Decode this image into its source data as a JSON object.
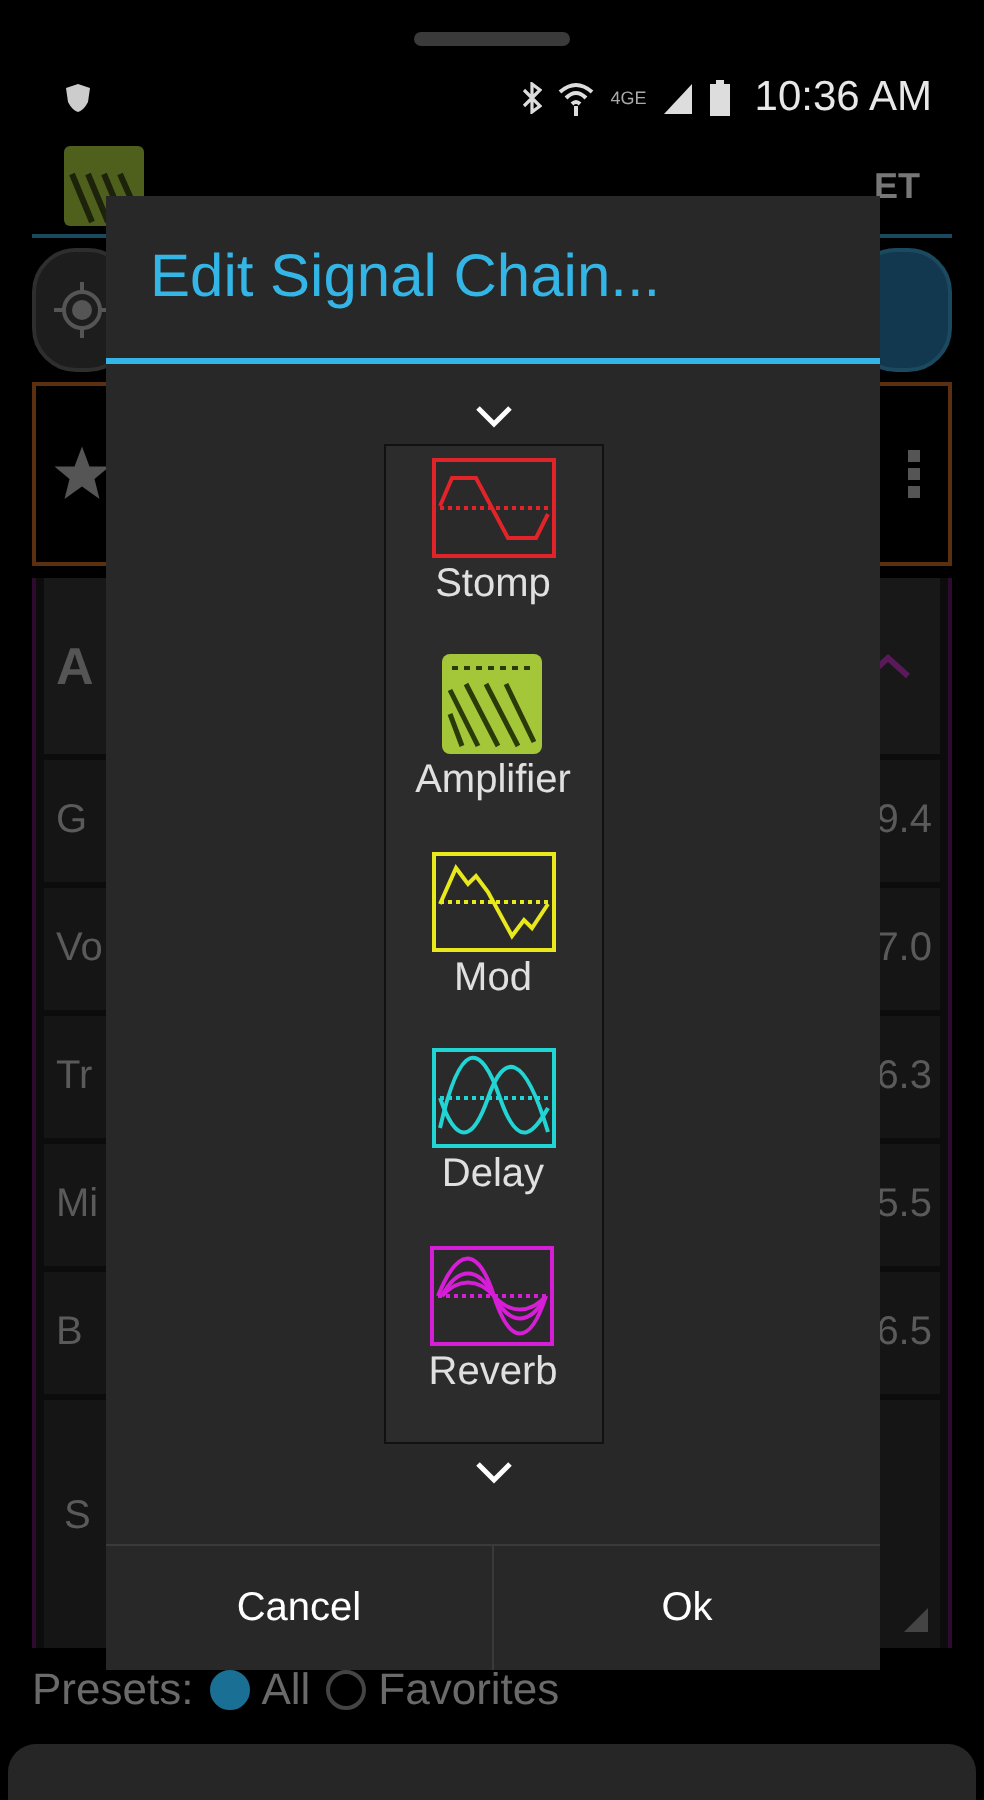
{
  "status_bar": {
    "network_label": "4GE",
    "time": "10:36 AM"
  },
  "background": {
    "tab_partial": "ET",
    "section_partial": "A",
    "params": [
      {
        "label": "G",
        "value": "9.4"
      },
      {
        "label": "Vo",
        "value": "7.0"
      },
      {
        "label": "Tr",
        "value": "6.3"
      },
      {
        "label": "Mi",
        "value": "5.5"
      },
      {
        "label": "B",
        "value": "6.5"
      }
    ],
    "select_partial": "S",
    "presets": {
      "label": "Presets:",
      "options": [
        {
          "label": "All",
          "selected": true
        },
        {
          "label": "Favorites",
          "selected": false
        }
      ]
    }
  },
  "dialog": {
    "title": "Edit Signal Chain...",
    "blocks": [
      {
        "label": "Stomp",
        "kind": "stomp",
        "color": "#e0242a"
      },
      {
        "label": "Amplifier",
        "kind": "amp",
        "color": "#a4c639"
      },
      {
        "label": "Mod",
        "kind": "mod",
        "color": "#e8e81c"
      },
      {
        "label": "Delay",
        "kind": "delay",
        "color": "#22d4d4"
      },
      {
        "label": "Reverb",
        "kind": "reverb",
        "color": "#d61ed6"
      }
    ],
    "buttons": [
      "Cancel",
      "Ok"
    ]
  }
}
